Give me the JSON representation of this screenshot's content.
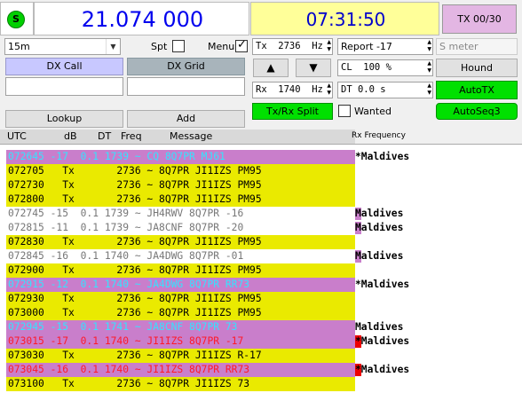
{
  "header": {
    "status_badge": "S",
    "frequency": "21.074 000",
    "clock": "07:31:50",
    "tx_counter": "TX 00/30"
  },
  "controls": {
    "band": "15m",
    "spt_label": "Spt",
    "menu_label": "Menu",
    "tx_freq": "Tx  2736  Hz",
    "report": "Report -17",
    "s_meter": "S meter",
    "dx_call_label": "DX Call",
    "dx_grid_label": "DX Grid",
    "up_arrow": "▲",
    "down_arrow": "▼",
    "cl_value": "CL  100 %",
    "hound_label": "Hound",
    "rx_freq": "Rx  1740  Hz",
    "dt_value": "DT 0.0 s",
    "autotx_label": "AutoTX",
    "split_label": "Tx/Rx Split",
    "wanted_label": "Wanted",
    "autoseq_label": "AutoSeq3",
    "lookup_label": "Lookup",
    "add_label": "Add",
    "dx_call_value": "",
    "dx_grid_value": ""
  },
  "log": {
    "headers": {
      "utc": "UTC",
      "db": "dB",
      "dt": "DT",
      "freq": "Freq",
      "message": "Message",
      "rx_frequency": "Rx Frequency"
    },
    "rows": [
      {
        "text": "072645 -17  0.1 1739 ~ CQ 8Q7PR MJ61",
        "note": "*Maldives",
        "bg": "#c97ecb",
        "fg": "#33e5ff"
      },
      {
        "text": "072705   Tx       2736 ~ 8Q7PR JI1IZS PM95",
        "note": "",
        "bg": "#eaea00",
        "fg": "#000000"
      },
      {
        "text": "072730   Tx       2736 ~ 8Q7PR JI1IZS PM95",
        "note": "",
        "bg": "#eaea00",
        "fg": "#000000"
      },
      {
        "text": "072800   Tx       2736 ~ 8Q7PR JI1IZS PM95",
        "note": "",
        "bg": "#eaea00",
        "fg": "#000000"
      },
      {
        "text": "072745 -15  0.1 1739 ~ JH4RWV 8Q7PR -16",
        "note": "Maldives",
        "bg": "#ffffff",
        "fg": "#777777",
        "marker": "#c97ecb"
      },
      {
        "text": "072815 -11  0.1 1739 ~ JA8CNF 8Q7PR -20",
        "note": "Maldives",
        "bg": "#ffffff",
        "fg": "#777777",
        "marker": "#c97ecb"
      },
      {
        "text": "072830   Tx       2736 ~ 8Q7PR JI1IZS PM95",
        "note": "",
        "bg": "#eaea00",
        "fg": "#000000"
      },
      {
        "text": "072845 -16  0.1 1740 ~ JA4DWG 8Q7PR -01",
        "note": "Maldives",
        "bg": "#ffffff",
        "fg": "#777777",
        "marker": "#c97ecb"
      },
      {
        "text": "072900   Tx       2736 ~ 8Q7PR JI1IZS PM95",
        "note": "",
        "bg": "#eaea00",
        "fg": "#000000"
      },
      {
        "text": "072915 -12  0.1 1740 ~ JA4DWG 8Q7PR RR73",
        "note": "*Maldives",
        "bg": "#c97ecb",
        "fg": "#33e5ff"
      },
      {
        "text": "072930   Tx       2736 ~ 8Q7PR JI1IZS PM95",
        "note": "",
        "bg": "#eaea00",
        "fg": "#000000"
      },
      {
        "text": "073000   Tx       2736 ~ 8Q7PR JI1IZS PM95",
        "note": "",
        "bg": "#eaea00",
        "fg": "#000000"
      },
      {
        "text": "072945 -15  0.1 1741 ~ JA8CNF 8Q7PR 73",
        "note": "Maldives",
        "bg": "#c97ecb",
        "fg": "#33e5ff"
      },
      {
        "text": "073015 -17  0.1 1740 ~ JI1IZS 8Q7PR -17",
        "note": "*Maldives",
        "bg": "#c97ecb",
        "fg": "#ff1a2a",
        "marker": "#ee0000"
      },
      {
        "text": "073030   Tx       2736 ~ 8Q7PR JI1IZS R-17",
        "note": "",
        "bg": "#eaea00",
        "fg": "#000000"
      },
      {
        "text": "073045 -16  0.1 1740 ~ JI1IZS 8Q7PR RR73",
        "note": "*Maldives",
        "bg": "#c97ecb",
        "fg": "#ff1a2a",
        "marker": "#ee0000"
      },
      {
        "text": "073100   Tx       2736 ~ 8Q7PR JI1IZS 73",
        "note": "",
        "bg": "#eaea00",
        "fg": "#000000"
      }
    ]
  },
  "colors": {
    "freq_text": "#0000ee",
    "clock_bg": "#ffff99",
    "tx_btn_bg": "#e3b6e3",
    "green": "#00e000",
    "dx_call_bg": "#c8c8ff",
    "dx_grid_bg": "#a8b4bb"
  }
}
